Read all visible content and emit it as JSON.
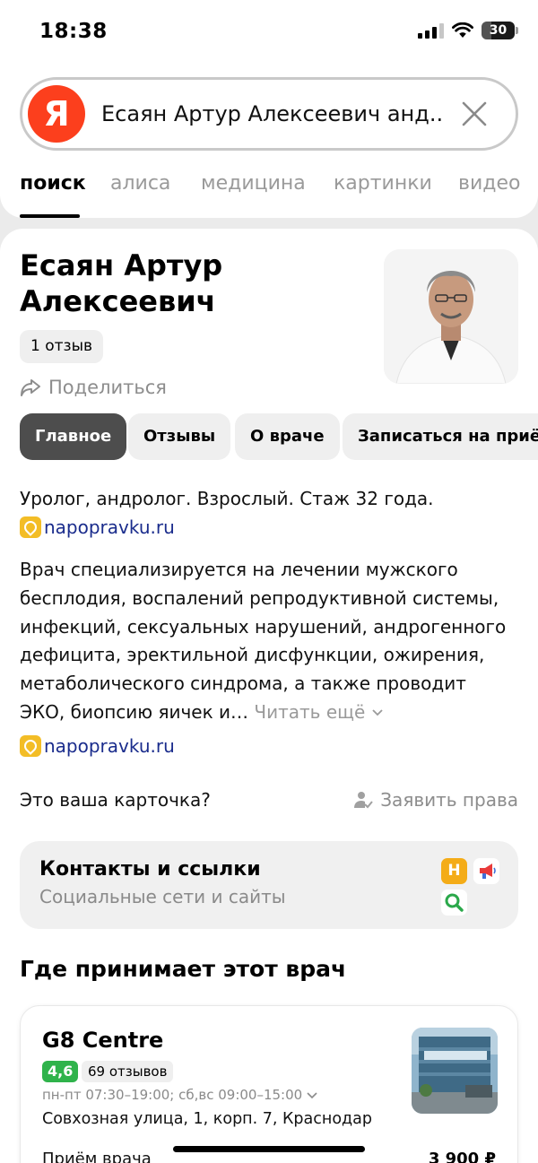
{
  "status_bar": {
    "time": "18:38",
    "battery": "30",
    "battery_level": 0.3
  },
  "search": {
    "query": "Есаян Артур Алексеевич анд...",
    "logo": "Я"
  },
  "tabs": [
    {
      "label": "поиск",
      "active": true
    },
    {
      "label": "алиса"
    },
    {
      "label": "медицина"
    },
    {
      "label": "картинки"
    },
    {
      "label": "видео"
    }
  ],
  "doctor": {
    "name_line1": "Есаян Артур",
    "name_line2": "Алексеевич",
    "reviews": "1 отзыв",
    "share": "Поделиться",
    "summary": "Уролог, андролог. Взрослый. Стаж 32 года.",
    "source": "napopravku.ru",
    "description_lines": [
      "Врач специализируется на лечении мужского",
      "бесплодия, воспалений репродуктивной системы,",
      "инфекций, сексуальных нарушений, андрогенного",
      "дефицита, эректильной дисфункции, ожирения,",
      "метаболического синдрома, а также проводит",
      "ЭКО, биопсию яичек и…"
    ],
    "read_more": "Читать ещё",
    "source2": "napopravku.ru"
  },
  "chips": [
    {
      "label": "Главное",
      "active": true
    },
    {
      "label": "Отзывы"
    },
    {
      "label": "О враче"
    },
    {
      "label": "Записаться на приём"
    }
  ],
  "claim": {
    "question": "Это ваша карточка?",
    "action": "Заявить права"
  },
  "contacts": {
    "title": "Контакты и ссылки",
    "subtitle": "Социальные сети и сайты",
    "icons": [
      "napopravku-icon",
      "megaphone-icon",
      "search-service-icon"
    ],
    "h_letter": "Н"
  },
  "where": {
    "title": "Где принимает этот врач"
  },
  "clinic": {
    "name": "G8 Centre",
    "rating": "4,6",
    "reviews": "69 отзывов",
    "hours": "пн-пт 07:30–19:00; сб,вс 09:00–15:00",
    "address": "Совхозная улица, 1, корп. 7, Краснодар",
    "service": "Приём врача",
    "price": "3 900 ₽"
  },
  "colors": {
    "yandex_red": "#fc3f1d",
    "link": "#1a2c8c",
    "rating_green": "#2fb34b",
    "chip_active": "#4d4d4d"
  }
}
